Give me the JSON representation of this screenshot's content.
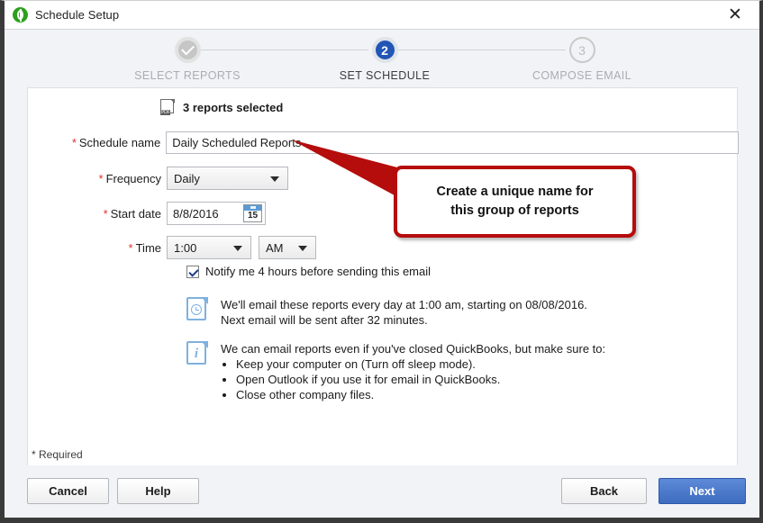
{
  "window": {
    "title": "Schedule Setup",
    "logo_icon": "quickbooks-logo-icon",
    "close_icon": "✕"
  },
  "stepper": {
    "steps": [
      {
        "number": "",
        "label": "SELECT REPORTS",
        "state": "completed"
      },
      {
        "number": "2",
        "label": "SET SCHEDULE",
        "state": "active"
      },
      {
        "number": "3",
        "label": "COMPOSE EMAIL",
        "state": "todo"
      }
    ]
  },
  "main": {
    "reports_selected": {
      "icon": "pdf-icon",
      "text": "3 reports selected"
    },
    "fields": {
      "schedule_name": {
        "label": "Schedule name",
        "required_mark": "*",
        "value": "Daily Scheduled Reports",
        "placeholder": "Schedule name"
      },
      "frequency": {
        "label": "Frequency",
        "required_mark": "*",
        "value": "Daily"
      },
      "start_date": {
        "label": "Start date",
        "required_mark": "*",
        "value": "8/8/2016",
        "calendar_day": "15"
      },
      "time": {
        "label": "Time",
        "required_mark": "*",
        "hour_value": "1:00",
        "meridiem_value": "AM"
      }
    },
    "notify_checkbox": {
      "label": "Notify me 4 hours before sending this email",
      "checked": true
    },
    "schedule_info": {
      "icon": "document-clock-icon",
      "line1": "We'll email these reports every day at 1:00 am, starting on 08/08/2016.",
      "line2": "Next email will be sent after 32 minutes."
    },
    "requirements_info": {
      "icon": "document-info-icon",
      "intro": "We can email reports even if you've closed QuickBooks, but make sure to:",
      "bullets": [
        "Keep your computer on (Turn off sleep mode).",
        "Open Outlook if you use it for email in QuickBooks.",
        "Close other company files."
      ]
    },
    "required_note": "* Required"
  },
  "callout": {
    "line1": "Create a unique name for",
    "line2": "this group of reports",
    "border_color": "#b50c0c"
  },
  "footer": {
    "cancel_label": "Cancel",
    "help_label": "Help",
    "back_label": "Back",
    "next_label": "Next",
    "next_color": "#3e6cc0"
  }
}
